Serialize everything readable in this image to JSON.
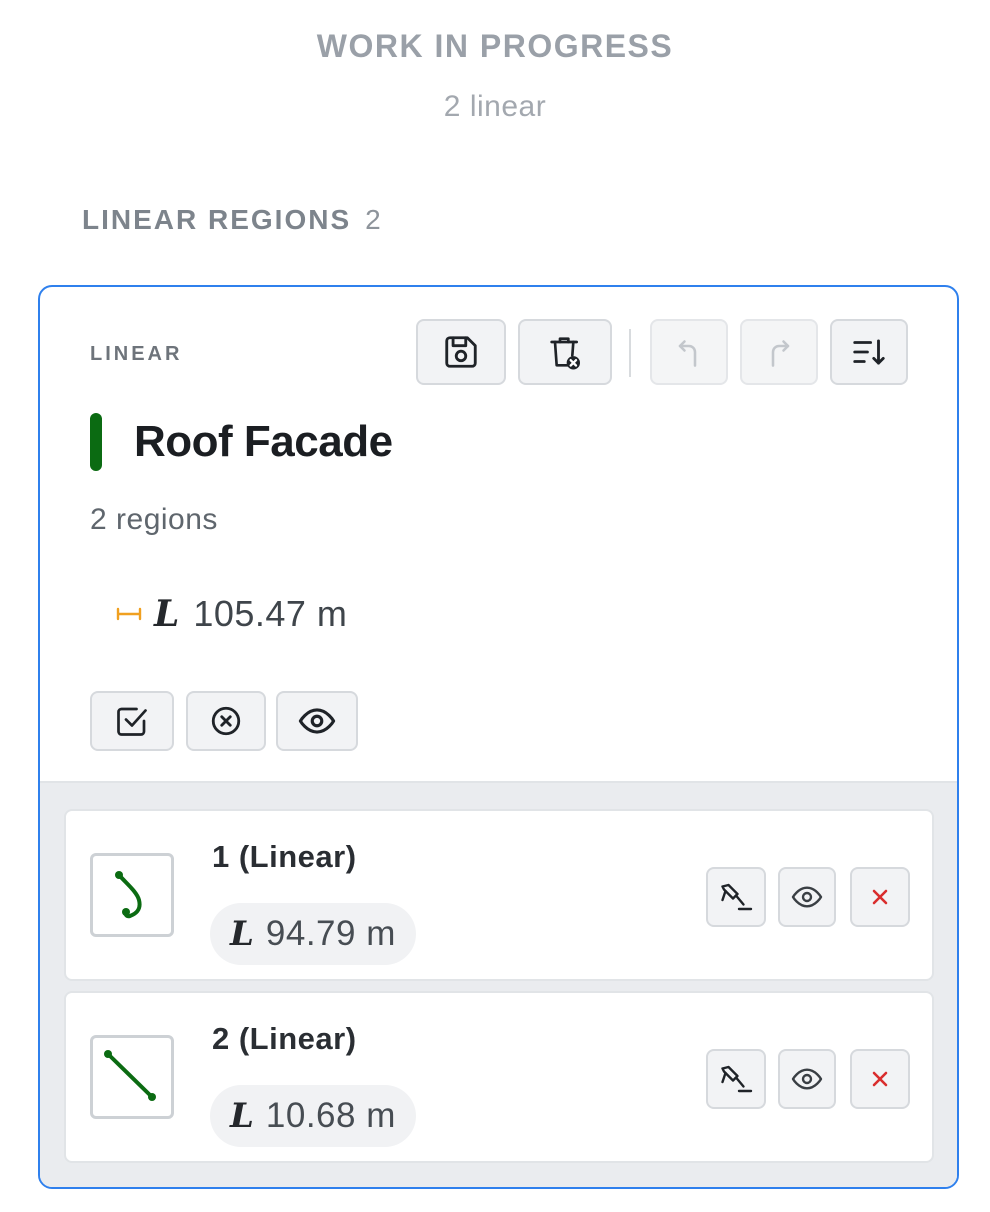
{
  "header": {
    "title": "WORK IN PROGRESS",
    "subtitle": "2 linear"
  },
  "section": {
    "label": "LINEAR REGIONS",
    "count": "2"
  },
  "group": {
    "kind_label": "LINEAR",
    "name": "Roof Facade",
    "color": "#0b6b12",
    "region_count": "2 regions",
    "length_symbol": "L",
    "length_value": "105.47 m",
    "toolbar": [
      "save-icon",
      "delete-icon",
      "undo-icon",
      "redo-icon",
      "sort-icon"
    ],
    "actions": [
      "check-square-icon",
      "close-circle-icon",
      "eye-icon"
    ]
  },
  "regions": [
    {
      "title": "1 (Linear)",
      "length_symbol": "L",
      "length_value": "94.79 m",
      "color": "#0b6b12"
    },
    {
      "title": "2 (Linear)",
      "length_symbol": "L",
      "length_value": "10.68 m",
      "color": "#0b6b12"
    }
  ],
  "colors": {
    "accent": "#2f80ed",
    "delete": "#d92d2d",
    "ruler": "#f0a020"
  }
}
